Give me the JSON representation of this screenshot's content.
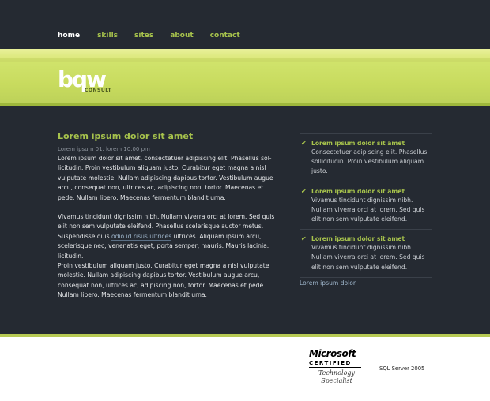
{
  "nav": {
    "items": [
      {
        "label": "home",
        "active": true
      },
      {
        "label": "skills",
        "active": false
      },
      {
        "label": "sites",
        "active": false
      },
      {
        "label": "about",
        "active": false
      },
      {
        "label": "contact",
        "active": false
      }
    ]
  },
  "logo": {
    "mark": "bqw",
    "sub": "CONSULT"
  },
  "article": {
    "title": "Lorem ipsum dolor sit amet",
    "meta": "Lorem ipsum 01. lorem 10.00 pm",
    "p1": "Lorem ipsum dolor sit amet, consectetuer adipiscing elit. Phasellus sol-licitudin. Proin vestibulum aliquam justo. Curabitur eget magna a nisl vulputate molestie. Nullam adipiscing dapibus tortor. Vestibulum augue arcu, consequat non, ultrices ac, adipiscing non, tortor. Maecenas et pede. Nullam libero. Maecenas fermentum blandit urna.",
    "p2_before": "Vivamus tincidunt dignissim nibh. Nullam viverra orci at lorem. Sed quis elit non sem vulputate eleifend. Phasellus scelerisque auctor metus. Suspendisse quis ",
    "p2_link": "odio id risus ultrices",
    "p2_after": " ultrices. Aliquam ipsum arcu, scelerisque nec, venenatis eget, porta semper, mauris. Mauris lacinia. licitudin.",
    "p3": "Proin vestibulum aliquam justo. Curabitur eget magna a nisl vulputate molestie. Nullam adipiscing dapibus tortor. Vestibulum augue arcu, consequat non, ultrices ac, adipiscing non, tortor. Maecenas et pede. Nullam libero. Maecenas fermentum blandit urna."
  },
  "sidebar": {
    "items": [
      {
        "title": "Lorem ipsum dolor sit amet",
        "desc": "Consectetuer adipiscing elit. Phasellus sollicitudin. Proin vestibulum aliquam justo."
      },
      {
        "title": "Lorem ipsum dolor sit amet",
        "desc": "Vivamus tincidunt dignissim nibh. Nullam viverra orci at lorem. Sed quis elit non sem vulputate eleifend."
      },
      {
        "title": "Lorem ipsum dolor sit amet",
        "desc": "Vivamus tincidunt dignissim nibh. Nullam viverra orci at lorem. Sed quis elit non sem vulputate eleifend."
      }
    ],
    "link": "Lorem ipsum dolor"
  },
  "footer": {
    "ms_brand": "Microsoft",
    "ms_cert": "CERTIFIED",
    "ms_ts1": "Technology",
    "ms_ts2": "Specialist",
    "sql": "SQL Server 2005"
  },
  "colors": {
    "accent": "#a7c34c",
    "background": "#252a32",
    "link": "#9fb6cc"
  }
}
